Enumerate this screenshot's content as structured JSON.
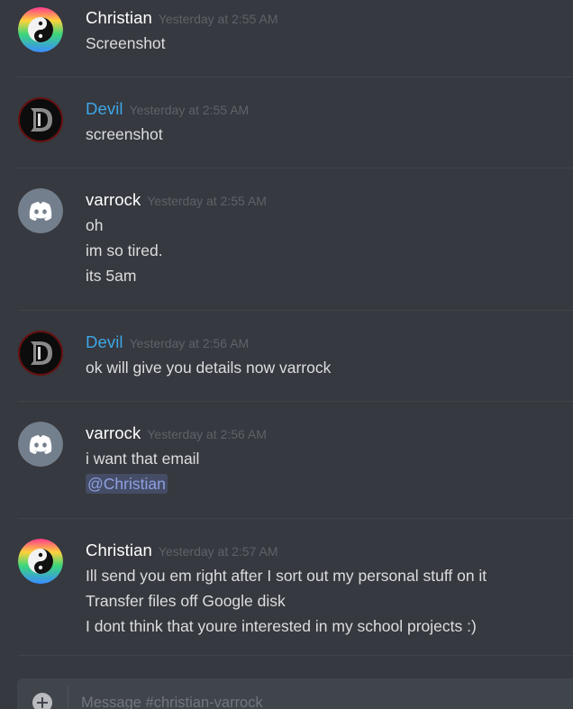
{
  "messages": [
    {
      "author": "Christian",
      "timestamp": "Yesterday at 2:55 AM",
      "lines": [
        "Screenshot"
      ]
    },
    {
      "author": "Devil",
      "timestamp": "Yesterday at 2:55 AM",
      "lines": [
        "screenshot"
      ]
    },
    {
      "author": "varrock",
      "timestamp": "Yesterday at 2:55 AM",
      "lines": [
        "oh",
        "im so tired.",
        "its 5am"
      ]
    },
    {
      "author": "Devil",
      "timestamp": "Yesterday at 2:56 AM",
      "lines": [
        "ok will give you details now varrock"
      ]
    },
    {
      "author": "varrock",
      "timestamp": "Yesterday at 2:56 AM",
      "lines": [
        "i want that email"
      ],
      "mention": "@Christian"
    },
    {
      "author": "Christian",
      "timestamp": "Yesterday at 2:57 AM",
      "lines": [
        "Ill send you em right after I sort out my personal stuff on it",
        "Transfer files off Google disk",
        "I dont think that youre interested in my school projects :)"
      ]
    }
  ],
  "composer": {
    "placeholder": "Message #christian-varrock"
  },
  "colors": {
    "background": "#36393f",
    "author_default": "#ffffff",
    "author_role_blue": "#3ea6e6",
    "message_text": "#dcddde",
    "timestamp": "#5f6268",
    "mention_text": "#8ea1e1"
  },
  "icons": {
    "christian_avatar": "yin-yang-rainbow-avatar",
    "devil_avatar": "devil-d-logo-avatar",
    "varrock_avatar": "discord-logo-avatar",
    "composer_upload": "plus-circle-icon"
  }
}
